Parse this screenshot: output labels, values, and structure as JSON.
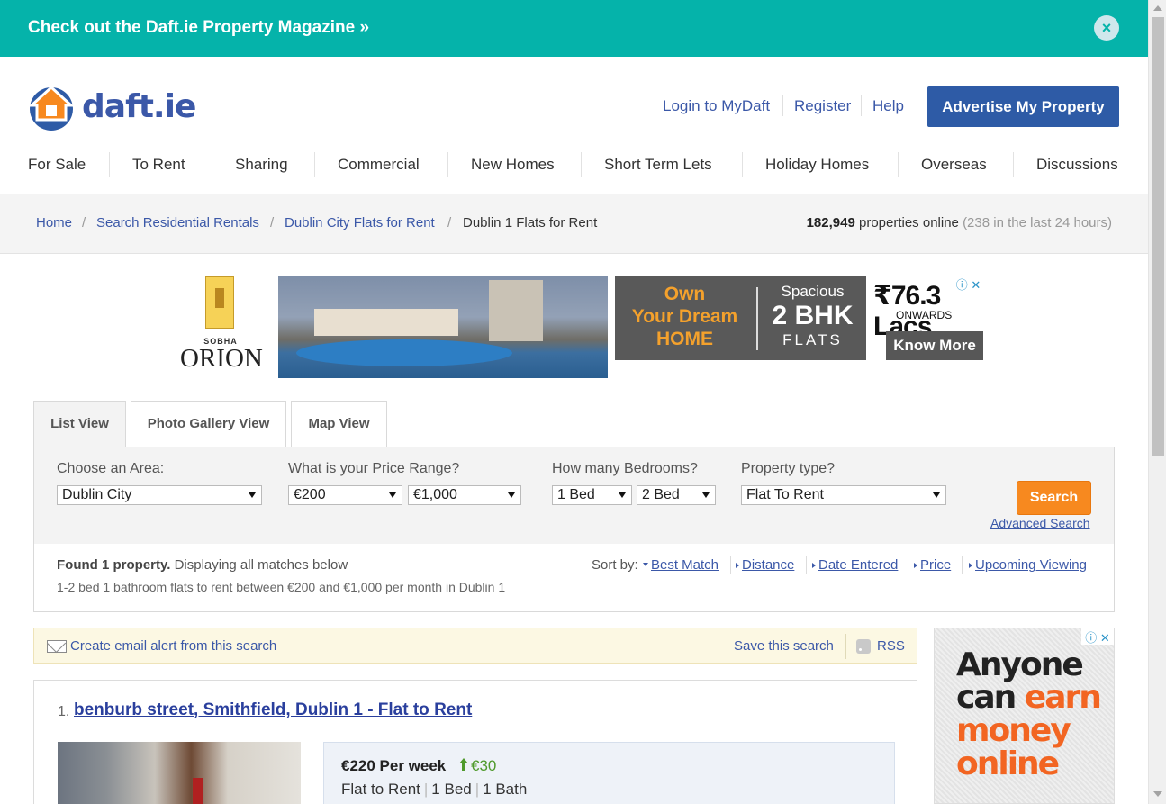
{
  "banner": {
    "text": "Check out the Daft.ie Property Magazine »",
    "close_icon": "×"
  },
  "header": {
    "logo_text": "daft.ie",
    "links": [
      "Login to MyDaft",
      "Register",
      "Help"
    ],
    "advertise_label": "Advertise My Property"
  },
  "nav": [
    "For Sale",
    "To Rent",
    "Sharing",
    "Commercial",
    "New Homes",
    "Short Term Lets",
    "Holiday Homes",
    "Overseas",
    "Discussions"
  ],
  "breadcrumb": {
    "items": [
      "Home",
      "Search Residential Rentals",
      "Dublin City Flats for Rent",
      "Dublin 1 Flats for Rent"
    ],
    "separator": "/"
  },
  "stats": {
    "count": "182,949",
    "label": "properties online",
    "recent": "(238 in the last 24 hours)"
  },
  "ad_banner": {
    "brand_small": "SOBHA",
    "brand_big": "ORION",
    "own_line1": "Own",
    "own_line2": "Your Dream",
    "own_line3": "HOME",
    "bhk_line1": "Spacious",
    "bhk_line2": "2 BHK",
    "bhk_line3": "FLATS",
    "price": "₹76.3 Lacs",
    "onwards": "ONWARDS",
    "cta": "Know More",
    "choices": "ⓘ ✕"
  },
  "tabs": [
    "List View",
    "Photo Gallery View",
    "Map View"
  ],
  "search": {
    "area_label": "Choose an Area:",
    "area_value": "Dublin City",
    "price_label": "What is your Price Range?",
    "price_min": "€200",
    "price_max": "€1,000",
    "beds_label": "How many Bedrooms?",
    "beds_min": "1 Bed",
    "beds_max": "2 Bed",
    "type_label": "Property type?",
    "type_value": "Flat To Rent",
    "button_label": "Search",
    "advanced_label": "Advanced Search"
  },
  "results": {
    "found_bold": "Found 1 property.",
    "found_rest": "Displaying all matches below",
    "description": "1-2 bed 1 bathroom flats to rent between €200 and €1,000 per month in Dublin 1",
    "sort_label": "Sort by:",
    "sort_options": [
      "Best Match",
      "Distance",
      "Date Entered",
      "Price",
      "Upcoming Viewing"
    ]
  },
  "alerts": {
    "email_alert": "Create email alert from this search",
    "save_search": "Save this search",
    "rss": "RSS"
  },
  "listing": {
    "number": "1.",
    "title": "benburb street, Smithfield, Dublin 1 - Flat to Rent",
    "price": "€220 Per week",
    "price_change": "€30",
    "type": "Flat to Rent",
    "beds": "1 Bed",
    "baths": "1 Bath"
  },
  "side_ad": {
    "line1": "Anyone",
    "line2_a": "can ",
    "line2_b": "earn",
    "line3": "money",
    "line4": "online",
    "choices": "ⓘ ✕"
  },
  "colors": {
    "banner": "#05b3aa",
    "brand_blue": "#2e5ba6",
    "search_orange": "#f7891f",
    "price_up_green": "#4f9a2c"
  }
}
